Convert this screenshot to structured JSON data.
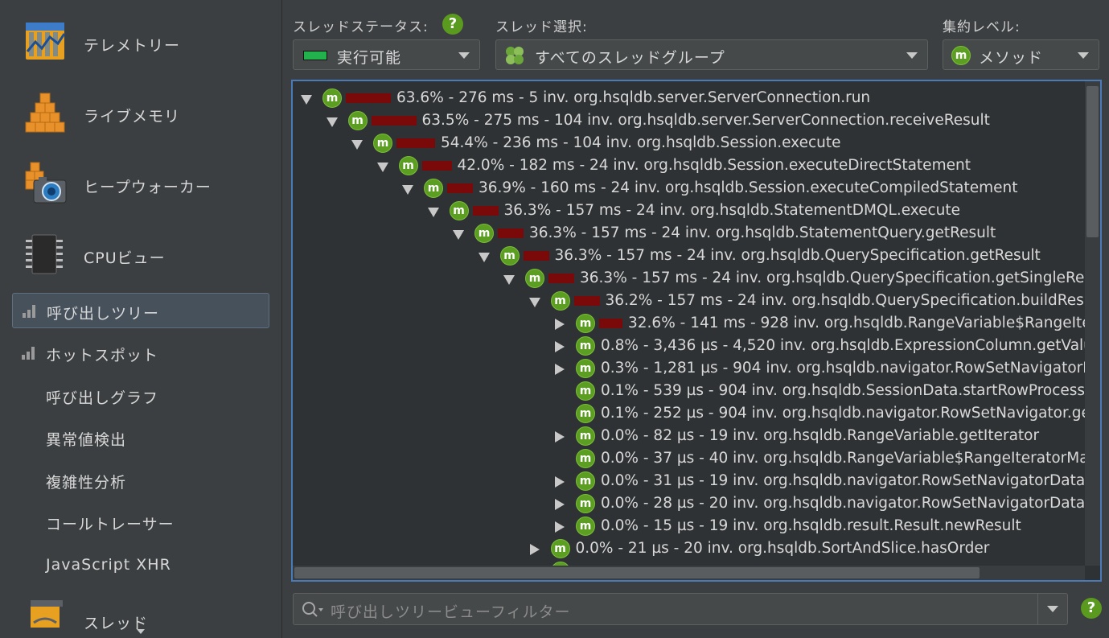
{
  "sidebar": {
    "big_items": [
      {
        "label": "テレメトリー",
        "icon": "telemetry-icon"
      },
      {
        "label": "ライブメモリ",
        "icon": "live-memory-icon"
      },
      {
        "label": "ヒープウォーカー",
        "icon": "heap-walker-icon"
      },
      {
        "label": "CPUビュー",
        "icon": "cpu-icon"
      }
    ],
    "sub_items": [
      {
        "label": "呼び出しツリー",
        "selected": true
      },
      {
        "label": "ホットスポット"
      },
      {
        "label": "呼び出しグラフ"
      },
      {
        "label": "異常値検出"
      },
      {
        "label": "複雑性分析"
      },
      {
        "label": "コールトレーサー"
      },
      {
        "label": "JavaScript XHR"
      }
    ],
    "partial_item": {
      "label": "スレッド",
      "icon": "threads-icon"
    }
  },
  "controls": {
    "thread_status": {
      "label": "スレッドステータス:",
      "value": "実行可能",
      "status_color": "#22b14c"
    },
    "thread_select": {
      "label": "スレッド選択:",
      "value": "すべてのスレッドグループ"
    },
    "aggregation": {
      "label": "集約レベル:",
      "value": "メソッド"
    },
    "help": "?"
  },
  "tree": {
    "accent": "#4a7ab8",
    "rows": [
      {
        "depth": 0,
        "toggle": "open",
        "bar": 1.0,
        "text": "63.6% - 276 ms - 5 inv. org.hsqldb.server.ServerConnection.run"
      },
      {
        "depth": 1,
        "toggle": "open",
        "bar": 1.0,
        "text": "63.5% - 275 ms - 104 inv. org.hsqldb.server.ServerConnection.receiveResult"
      },
      {
        "depth": 2,
        "toggle": "open",
        "bar": 0.86,
        "text": "54.4% - 236 ms - 104 inv. org.hsqldb.Session.execute"
      },
      {
        "depth": 3,
        "toggle": "open",
        "bar": 0.66,
        "text": "42.0% - 182 ms - 24 inv. org.hsqldb.Session.executeDirectStatement"
      },
      {
        "depth": 4,
        "toggle": "open",
        "bar": 0.58,
        "text": "36.9% - 160 ms - 24 inv. org.hsqldb.Session.executeCompiledStatement"
      },
      {
        "depth": 5,
        "toggle": "open",
        "bar": 0.57,
        "text": "36.3% - 157 ms - 24 inv. org.hsqldb.StatementDMQL.execute"
      },
      {
        "depth": 6,
        "toggle": "open",
        "bar": 0.57,
        "text": "36.3% - 157 ms - 24 inv. org.hsqldb.StatementQuery.getResult"
      },
      {
        "depth": 7,
        "toggle": "open",
        "bar": 0.57,
        "text": "36.3% - 157 ms - 24 inv. org.hsqldb.QuerySpecification.getResult"
      },
      {
        "depth": 8,
        "toggle": "open",
        "bar": 0.57,
        "text": "36.3% - 157 ms - 24 inv. org.hsqldb.QuerySpecification.getSingleResult"
      },
      {
        "depth": 9,
        "toggle": "open",
        "bar": 0.57,
        "text": "36.2% - 157 ms - 24 inv. org.hsqldb.QuerySpecification.buildResult"
      },
      {
        "depth": 10,
        "toggle": "closed",
        "bar": 0.51,
        "text": "32.6% - 141 ms - 928 inv. org.hsqldb.RangeVariable$RangeIteratorMain.next"
      },
      {
        "depth": 10,
        "toggle": "closed",
        "bar": 0,
        "text": "0.8% - 3,436 µs - 4,520 inv. org.hsqldb.ExpressionColumn.getValue"
      },
      {
        "depth": 10,
        "toggle": "closed",
        "bar": 0,
        "text": "0.3% - 1,281 µs - 904 inv. org.hsqldb.navigator.RowSetNavigatorData.add"
      },
      {
        "depth": 10,
        "toggle": "none",
        "bar": 0,
        "text": "0.1% - 539 µs - 904 inv. org.hsqldb.SessionData.startRowProcessing"
      },
      {
        "depth": 10,
        "toggle": "none",
        "bar": 0,
        "text": "0.1% - 252 µs - 904 inv. org.hsqldb.navigator.RowSetNavigator.getSize"
      },
      {
        "depth": 10,
        "toggle": "closed",
        "bar": 0,
        "text": "0.0% - 82 µs - 19 inv. org.hsqldb.RangeVariable.getIterator"
      },
      {
        "depth": 10,
        "toggle": "none",
        "bar": 0,
        "text": "0.0% - 37 µs - 40 inv. org.hsqldb.RangeVariable$RangeIteratorMain.reset"
      },
      {
        "depth": 10,
        "toggle": "closed",
        "bar": 0,
        "text": "0.0% - 31 µs - 19 inv. org.hsqldb.navigator.RowSetNavigatorData.sortFull"
      },
      {
        "depth": 10,
        "toggle": "closed",
        "bar": 0,
        "text": "0.0% - 28 µs - 20 inv. org.hsqldb.navigator.RowSetNavigatorData.reset"
      },
      {
        "depth": 10,
        "toggle": "closed",
        "bar": 0,
        "text": "0.0% - 15 µs - 19 inv. org.hsqldb.result.Result.newResult"
      },
      {
        "depth": 9,
        "toggle": "closed",
        "bar": 0,
        "text": "0.0% - 21 µs - 20 inv. org.hsqldb.SortAndSlice.hasOrder"
      },
      {
        "depth": 9,
        "toggle": "closed",
        "bar": 0,
        "text": ""
      }
    ]
  },
  "filter": {
    "placeholder": "呼び出しツリービューフィルター",
    "help": "?"
  }
}
